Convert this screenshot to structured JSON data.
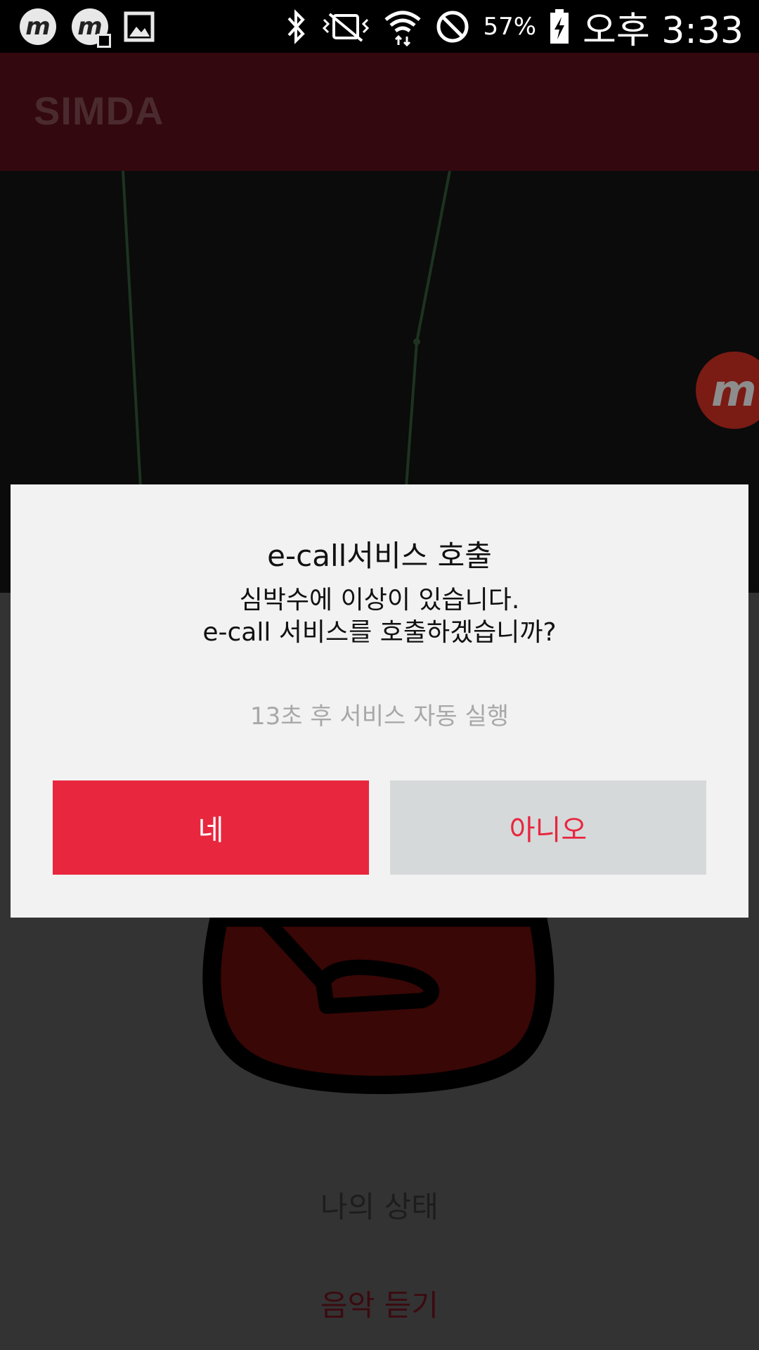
{
  "status_bar": {
    "notification_icons": [
      "mobizen-icon",
      "mobizen-record-icon",
      "gallery-icon"
    ],
    "system_icons": [
      "bluetooth-icon",
      "vibrate-mute-icon",
      "wifi-icon",
      "block-icon"
    ],
    "battery_percent": "57%",
    "time": "오후 3:33"
  },
  "app_bar": {
    "title": "SIMDA"
  },
  "background": {
    "menu_status": "나의 상태",
    "menu_music": "음악 듣기",
    "floating_button": "m"
  },
  "dialog": {
    "title": "e-call서비스 호출",
    "message_line1": "심박수에 이상이 있습니다.",
    "message_line2": "e-call 서비스를 호출하겠습니까?",
    "countdown": "13초 후 서비스 자동 실행",
    "yes_label": "네",
    "no_label": "아니오"
  },
  "colors": {
    "accent": "#e8263e",
    "app_bar": "#33080e",
    "dialog_bg": "#f2f2f2",
    "secondary_button": "#d5d9da"
  }
}
